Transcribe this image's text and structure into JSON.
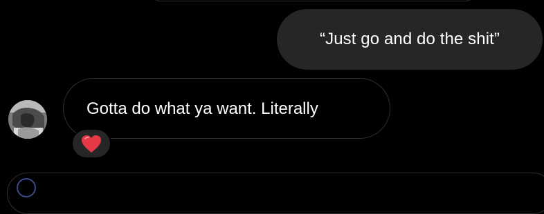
{
  "thread": {
    "sent_message": "“Just go and do the shit”",
    "received_message": "Gotta do what ya want. Literally",
    "reaction": {
      "icon": "red-heart-icon",
      "color": "#e53946"
    }
  },
  "colors": {
    "background": "#000000",
    "sent_bubble": "#262626",
    "received_bubble_border": "#303030",
    "text": "#ffffff"
  }
}
